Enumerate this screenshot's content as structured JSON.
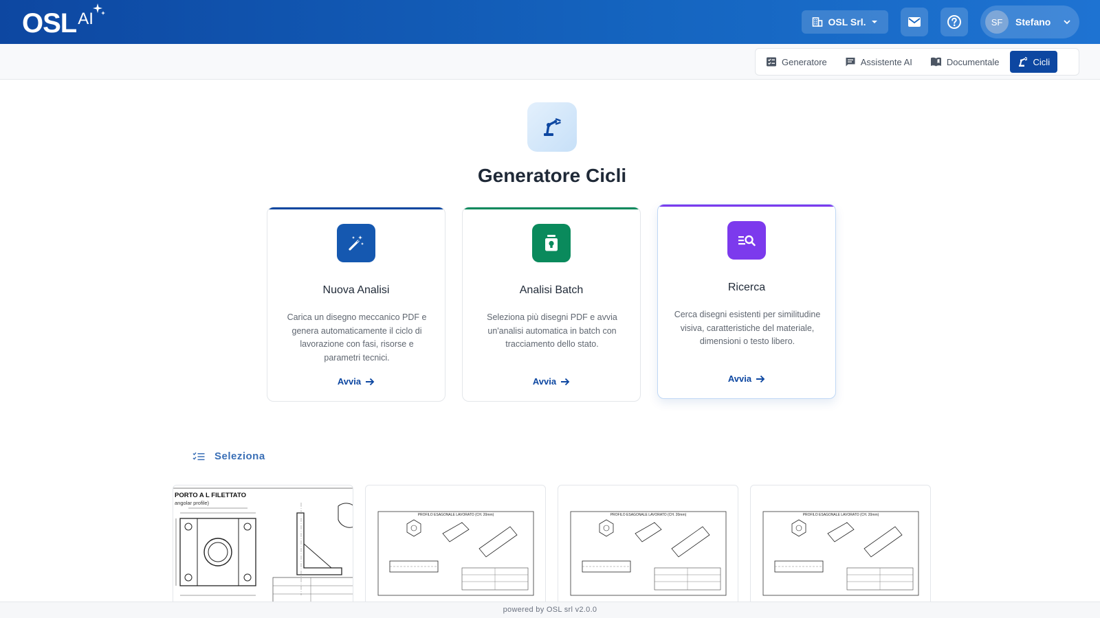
{
  "header": {
    "logo_main": "OSL",
    "logo_sup": "AI",
    "org_label": "OSL Srl.",
    "user_initials": "SF",
    "user_name": "Stefano"
  },
  "nav": {
    "tabs": [
      {
        "label": "Generatore",
        "icon": "checklist-icon",
        "active": false
      },
      {
        "label": "Assistente AI",
        "icon": "chat-icon",
        "active": false
      },
      {
        "label": "Documentale",
        "icon": "book-icon",
        "active": false
      },
      {
        "label": "Cicli",
        "icon": "robot-arm-icon",
        "active": true
      }
    ]
  },
  "main": {
    "title": "Generatore Cicli",
    "cards": [
      {
        "title": "Nuova Analisi",
        "description": "Carica un disegno meccanico PDF e genera automaticamente il ciclo di lavorazione con fasi, risorse e parametri tecnici.",
        "action": "Avvia",
        "accent": "#0d47a1",
        "icon": "magic-wand-icon"
      },
      {
        "title": "Analisi Batch",
        "description": "Seleziona più disegni PDF e avvia un'analisi automatica in batch con tracciamento dello stato.",
        "action": "Avvia",
        "accent": "#0a8a5c",
        "icon": "batch-jar-icon"
      },
      {
        "title": "Ricerca",
        "description": "Cerca disegni esistenti per similitudine visiva, caratteristiche del materiale, dimensioni o testo libero.",
        "action": "Avvia",
        "accent": "#7c3aed",
        "icon": "search-list-icon"
      }
    ],
    "select_label": "Seleziona",
    "thumbnails": [
      {
        "title": "PORTO A L FILETTATO",
        "subtitle": "angolar profile)"
      },
      {
        "title": "PROFILO ESAGONALE LAVORATO (CH. 20mm)"
      },
      {
        "title": "PROFILO ESAGONALE LAVORATO (CH. 20mm)"
      },
      {
        "title": "PROFILO ESAGONALE LAVORATO (CH. 20mm)"
      }
    ]
  },
  "footer": {
    "text": "powered by OSL srl v2.0.0"
  },
  "colors": {
    "primary": "#0d47a1",
    "green": "#0a8a5c",
    "purple": "#7c3aed"
  }
}
